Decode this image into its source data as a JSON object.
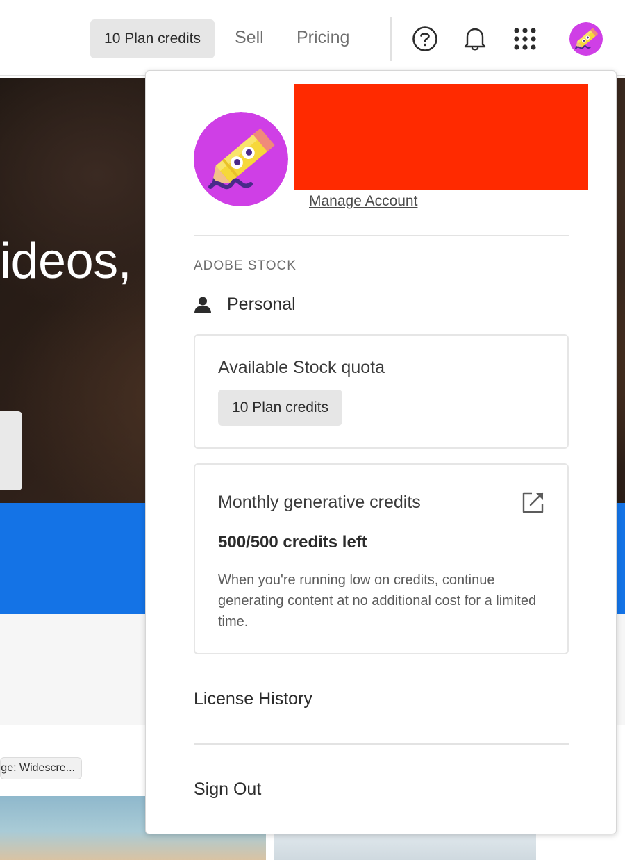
{
  "header": {
    "credits_pill": "10 Plan credits",
    "nav": {
      "sell": "Sell",
      "pricing": "Pricing"
    },
    "icons": [
      "help-icon",
      "bell-icon",
      "apps-grid-icon",
      "avatar"
    ]
  },
  "background": {
    "hero_text": "ideos,",
    "chip_text": "ge: Widescre..."
  },
  "account_menu": {
    "manage_account": "Manage Account",
    "section_label": "ADOBE STOCK",
    "profile": {
      "icon": "person-icon",
      "label": "Personal"
    },
    "quota_card": {
      "title": "Available Stock quota",
      "pill": "10 Plan credits"
    },
    "generative_card": {
      "title": "Monthly generative credits",
      "icon": "external-link-icon",
      "count": "500/500 credits left",
      "description": "When you're running low on credits, continue generating content at no additional cost for a limited time."
    },
    "license_history": "License History",
    "sign_out": "Sign Out"
  },
  "colors": {
    "accent_blue": "#1473e6",
    "redaction": "#ff2a00",
    "avatar_bg": "#cf3fe6"
  }
}
